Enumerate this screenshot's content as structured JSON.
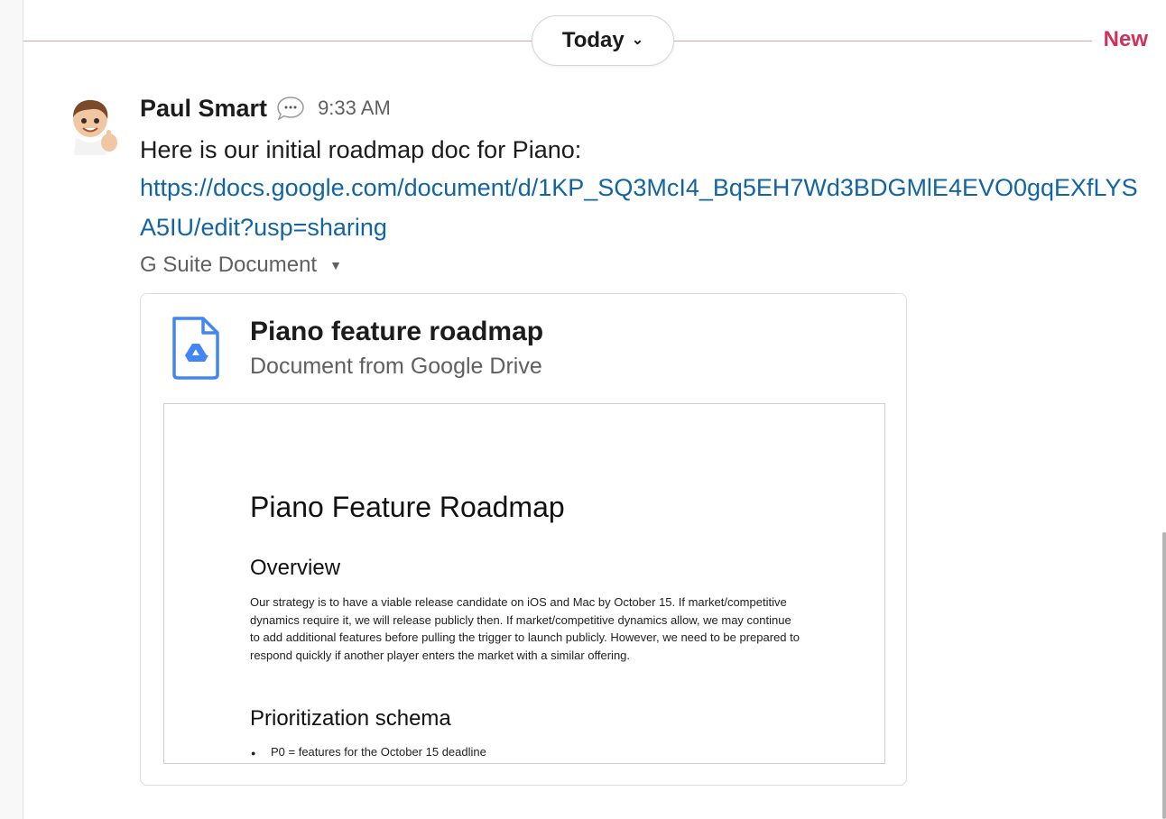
{
  "divider": {
    "day_label": "Today",
    "new_label": "New"
  },
  "message": {
    "sender": "Paul Smart",
    "timestamp": "9:33 AM",
    "text": "Here is our initial roadmap doc for Piano:",
    "link": "https://docs.google.com/document/d/1KP_SQ3McI4_Bq5EH7Wd3BDGMlE4EVO0gqEXfLYSA5IU/edit?usp=sharing"
  },
  "attachment": {
    "label": "G Suite Document",
    "title": "Piano feature roadmap",
    "subtitle": "Document from Google Drive",
    "preview": {
      "title": "Piano Feature Roadmap",
      "heading1": "Overview",
      "body": "Our strategy is to have a viable release candidate on iOS and Mac by October 15. If market/competitive dynamics require it, we will release publicly then. If market/competitive dynamics allow, we may continue to add additional features before pulling the trigger to launch publicly. However, we need to be prepared to respond quickly if another player enters the market with a similar offering.",
      "heading2": "Prioritization schema",
      "bullet1": "P0 = features for the October 15 deadline"
    }
  },
  "icons": {
    "avatar": "memoji-avatar-thumbs-up",
    "status": "speech-bubble-icon",
    "day_chevron": "chevron-down-icon",
    "attach_caret": "caret-down-icon",
    "doc": "google-drive-doc-icon"
  },
  "colors": {
    "link": "#1264a3",
    "new_divider": "#d0305a",
    "drive_icon": "#4285f4"
  }
}
